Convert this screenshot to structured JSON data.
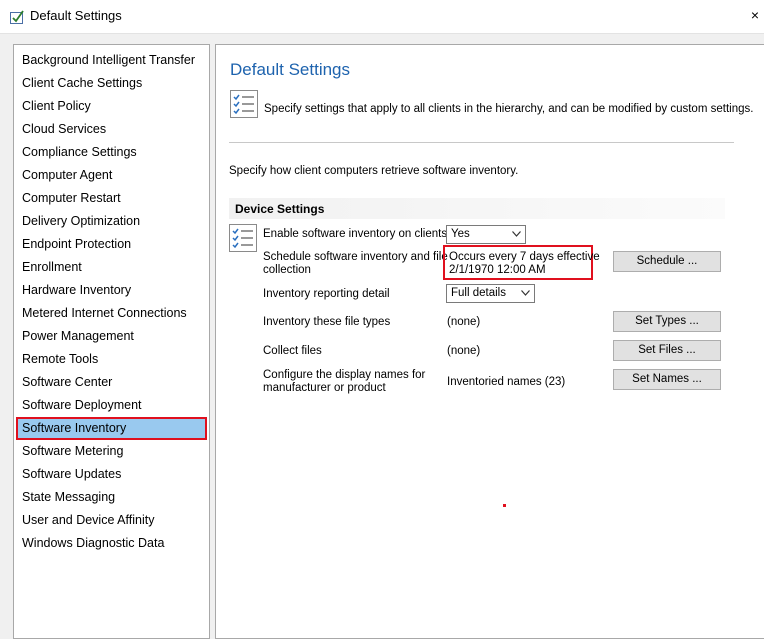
{
  "window": {
    "title": "Default Settings",
    "close_glyph": "×",
    "icon": "settings-check-icon"
  },
  "sidebar": {
    "items": [
      {
        "label": "Background Intelligent Transfer"
      },
      {
        "label": "Client Cache Settings"
      },
      {
        "label": "Client Policy"
      },
      {
        "label": "Cloud Services"
      },
      {
        "label": "Compliance Settings"
      },
      {
        "label": "Computer Agent"
      },
      {
        "label": "Computer Restart"
      },
      {
        "label": "Delivery Optimization"
      },
      {
        "label": "Endpoint Protection"
      },
      {
        "label": "Enrollment"
      },
      {
        "label": "Hardware Inventory"
      },
      {
        "label": "Metered Internet Connections"
      },
      {
        "label": "Power Management"
      },
      {
        "label": "Remote Tools"
      },
      {
        "label": "Software Center"
      },
      {
        "label": "Software Deployment"
      },
      {
        "label": "Software Inventory",
        "selected": true
      },
      {
        "label": "Software Metering"
      },
      {
        "label": "Software Updates"
      },
      {
        "label": "State Messaging"
      },
      {
        "label": "User and Device Affinity"
      },
      {
        "label": "Windows Diagnostic Data"
      }
    ],
    "selected_color": "#99c9ef",
    "highlight_color": "#e0101e"
  },
  "main": {
    "title": "Default Settings",
    "title_color": "#1e63ae",
    "header_text": "Specify settings that apply to all clients in the hierarchy, and can be modified by custom settings.",
    "intro": "Specify how client computers retrieve software inventory.",
    "section_title": "Device Settings",
    "rows": {
      "enable": {
        "label": "Enable software inventory on clients",
        "value": "Yes"
      },
      "schedule": {
        "label_line1": "Schedule software inventory and file",
        "label_line2": "collection",
        "value_line1": "Occurs every 7 days effective",
        "value_line2": "2/1/1970 12:00 AM",
        "button": "Schedule ..."
      },
      "detail": {
        "label": "Inventory reporting detail",
        "value": "Full details"
      },
      "file_types": {
        "label": "Inventory these file types",
        "value": "(none)",
        "button": "Set Types ..."
      },
      "collect": {
        "label": "Collect files",
        "value": "(none)",
        "button": "Set Files ..."
      },
      "names": {
        "label_line1": "Configure the display names for",
        "label_line2": "manufacturer or product",
        "value": "Inventoried names (23)",
        "button": "Set Names ..."
      }
    }
  }
}
